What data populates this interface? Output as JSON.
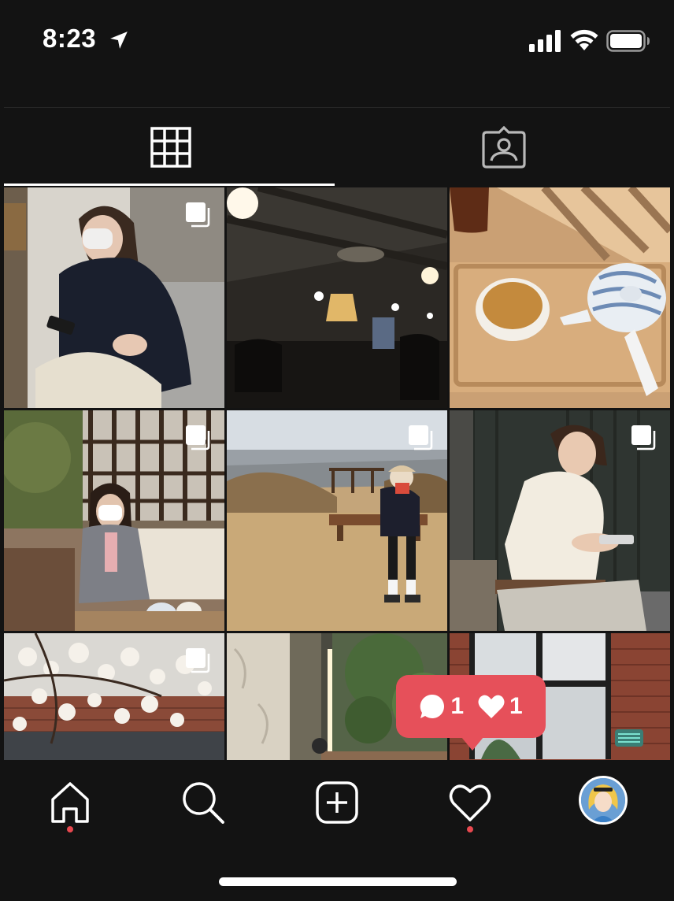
{
  "status_bar": {
    "time": "8:23"
  },
  "tabs": [
    {
      "name": "posts-grid",
      "icon": "grid-icon",
      "active": true
    },
    {
      "name": "tagged",
      "icon": "tagged-person-icon",
      "active": false
    }
  ],
  "grid": {
    "posts": [
      {
        "scene": "woman-in-mask-with-phone",
        "multi": true
      },
      {
        "scene": "dim-cafe-interior-with-lamps",
        "multi": false
      },
      {
        "scene": "tea-set-on-wooden-tray",
        "multi": false
      },
      {
        "scene": "woman-in-cafe-by-window",
        "multi": true
      },
      {
        "scene": "person-on-bench-mountain-view",
        "multi": true
      },
      {
        "scene": "woman-with-phone-dark-wall",
        "multi": true
      },
      {
        "scene": "magnolia-tree-brick-building",
        "multi": true
      },
      {
        "scene": "stone-wall-and-plants",
        "multi": false
      },
      {
        "scene": "brick-wall-and-window",
        "multi": false
      }
    ]
  },
  "notification": {
    "comments": "1",
    "likes": "1"
  },
  "bottom_nav": {
    "items": [
      "home-icon",
      "search-icon",
      "new-post-icon",
      "activity-heart-icon",
      "profile-avatar"
    ]
  },
  "colors": {
    "background": "#131313",
    "accent": "#e6505a",
    "dot": "#e8484f"
  }
}
